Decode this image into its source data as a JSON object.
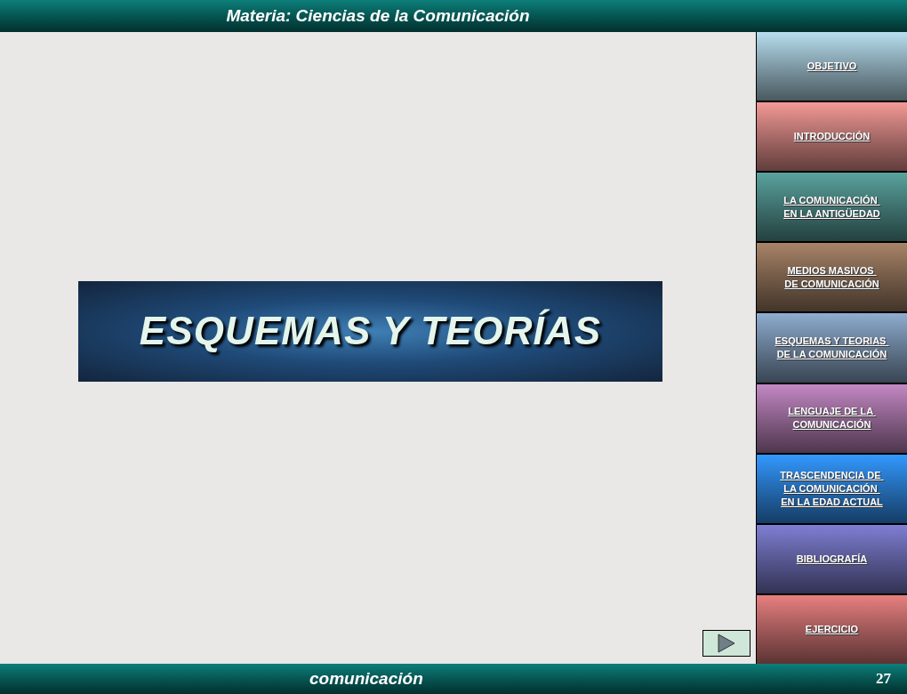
{
  "header": {
    "title": "Materia: Ciencias de la Comunicación"
  },
  "banner": {
    "title": "ESQUEMAS Y TEORÍAS"
  },
  "menu": [
    {
      "lines": [
        "OBJETIVO"
      ],
      "color": "#b8dff0"
    },
    {
      "lines": [
        "INTRODUCCIÓN"
      ],
      "color": "#f49a96"
    },
    {
      "lines": [
        "LA COMUNICACIÓN ",
        "EN LA ANTIGÜEDAD"
      ],
      "color": "#5aa39f"
    },
    {
      "lines": [
        "MEDIOS MASIVOS ",
        "DE COMUNICACIÓN"
      ],
      "color": "#a88468"
    },
    {
      "lines": [
        "ESQUEMAS Y TEORIAS ",
        "DE LA COMUNICACIÓN"
      ],
      "color": "#8fadd0"
    },
    {
      "lines": [
        "LENGUAJE DE LA ",
        "COMUNICACIÓN"
      ],
      "color": "#c489c4"
    },
    {
      "lines": [
        "TRASCENDENCIA DE ",
        "LA COMUNICACIÓN ",
        "EN LA EDAD ACTUAL"
      ],
      "color": "#3399ff"
    },
    {
      "lines": [
        "BIBLIOGRAFÍA"
      ],
      "color": "#7f7fd4"
    },
    {
      "lines": [
        "EJERCICIO"
      ],
      "color": "#e88080"
    }
  ],
  "footer": {
    "title": "comunicación",
    "page": "27"
  }
}
